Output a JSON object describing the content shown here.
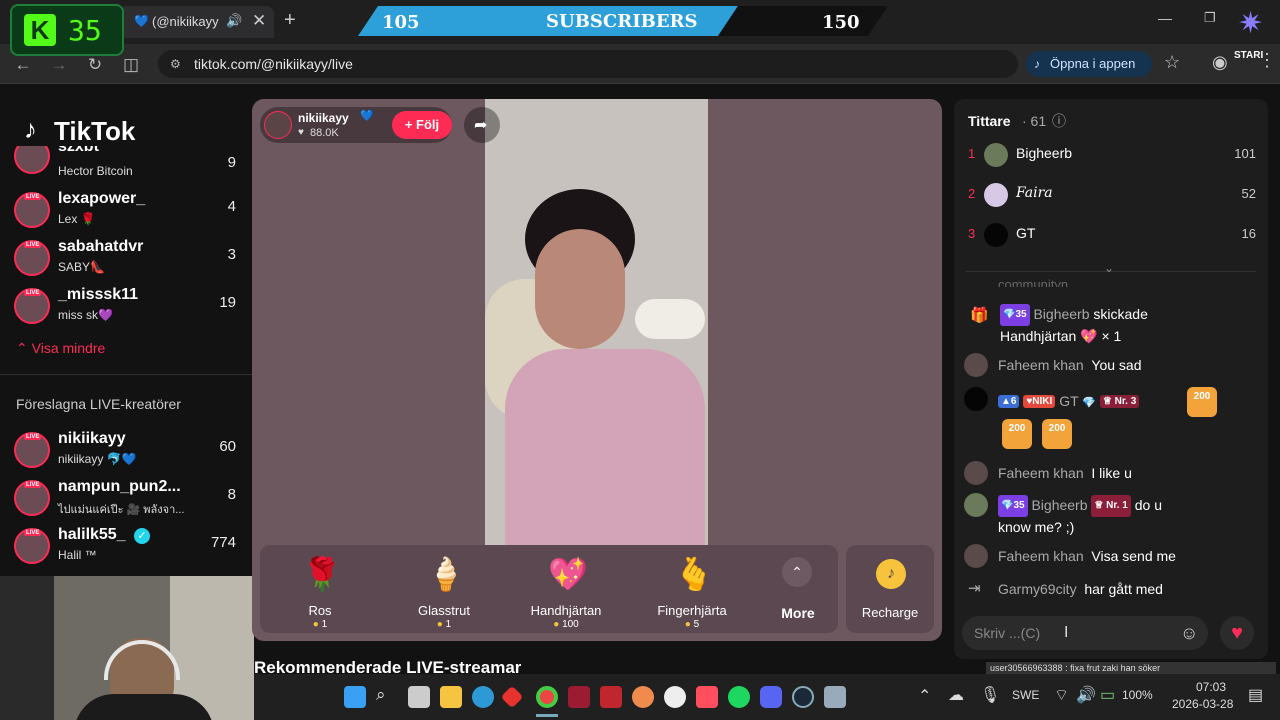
{
  "browser": {
    "tab_title": "(@nikiikayy",
    "url": "tiktok.com/@nikiikayy/live",
    "open_app_label": "Öppna i appen"
  },
  "overlay": {
    "k_number": "35",
    "sub_current": "105",
    "sub_label": "SUBSCRIBERS",
    "sub_goal": "150",
    "stari_label": "STARI"
  },
  "sidebar": {
    "logo": "TikTok",
    "following": [
      {
        "name": "szxbt",
        "sub": "Hector Bitcoin",
        "count": "9"
      },
      {
        "name": "lexapower_",
        "sub": "Lex 🌹",
        "count": "4"
      },
      {
        "name": "sabahatdvr",
        "sub": "SABY👠",
        "count": "3"
      },
      {
        "name": "_misssk11",
        "sub": "miss sk💜",
        "count": "19"
      }
    ],
    "show_less": "Visa mindre",
    "suggested_title": "Föreslagna LIVE-kreatörer",
    "suggested": [
      {
        "name": "nikiikayy",
        "sub": "nikiikayy 🐬💙",
        "count": "60"
      },
      {
        "name": "nampun_pun2...",
        "sub": "ไปแม่นแค่เปีะ 🎥 พลังจา...",
        "count": "8"
      },
      {
        "name": "halilk55_",
        "sub": "Halil ™",
        "count": "774"
      }
    ],
    "live_tag": "LIVE"
  },
  "player": {
    "host_name": "nikiikayy",
    "host_likes": "88.0K",
    "follow_label": "+ Följ",
    "gifts": [
      {
        "name": "Ros",
        "price": "1"
      },
      {
        "name": "Glasstrut",
        "price": "1"
      },
      {
        "name": "Handhjärtan",
        "price": "100"
      },
      {
        "name": "Fingerhjärta",
        "price": "5"
      }
    ],
    "more_label": "More",
    "recharge_label": "Recharge"
  },
  "recommended_title": "Rekommenderade LIVE-streamar",
  "chat": {
    "viewers_title": "Tittare",
    "viewers_count": "· 61",
    "top_viewers": [
      {
        "rank": "1",
        "name": "Bigheerb",
        "score": "101"
      },
      {
        "rank": "2",
        "name": "Faira",
        "score": "52"
      },
      {
        "rank": "3",
        "name": "GT",
        "score": "16"
      }
    ],
    "cut_text": "communityn.",
    "messages": [
      {
        "name": "Bigheerb",
        "level": "35",
        "text": "skickade",
        "line2": "Handhjärtan 💖 × 1"
      },
      {
        "name": "Faheem khan",
        "text": "You sad"
      },
      {
        "level": "6",
        "fan": "NIKI",
        "name": "GT",
        "rank": "Nr. 3"
      },
      {
        "name": "Faheem khan",
        "text": "I like u"
      },
      {
        "name": "Bigheerb",
        "level": "35",
        "rank": "Nr. 1",
        "text": "do u",
        "line2": "know me? ;)"
      },
      {
        "name": "Faheem khan",
        "text": "Visa send me"
      },
      {
        "name": "Garmy69city",
        "text": "har gått med"
      }
    ],
    "minutes_badge": "200",
    "input_placeholder": "Skriv ...(C)"
  },
  "taskbar": {
    "lang": "SWE",
    "battery": "100%",
    "time": "07:03",
    "date": "2026-03-28",
    "notification": "user30566963388 : fixa frut zaki han söker"
  },
  "colors": {
    "tiktok_red": "#fe2c55",
    "player_bg": "#6e5860",
    "chat_bg": "#1d1d1d"
  }
}
